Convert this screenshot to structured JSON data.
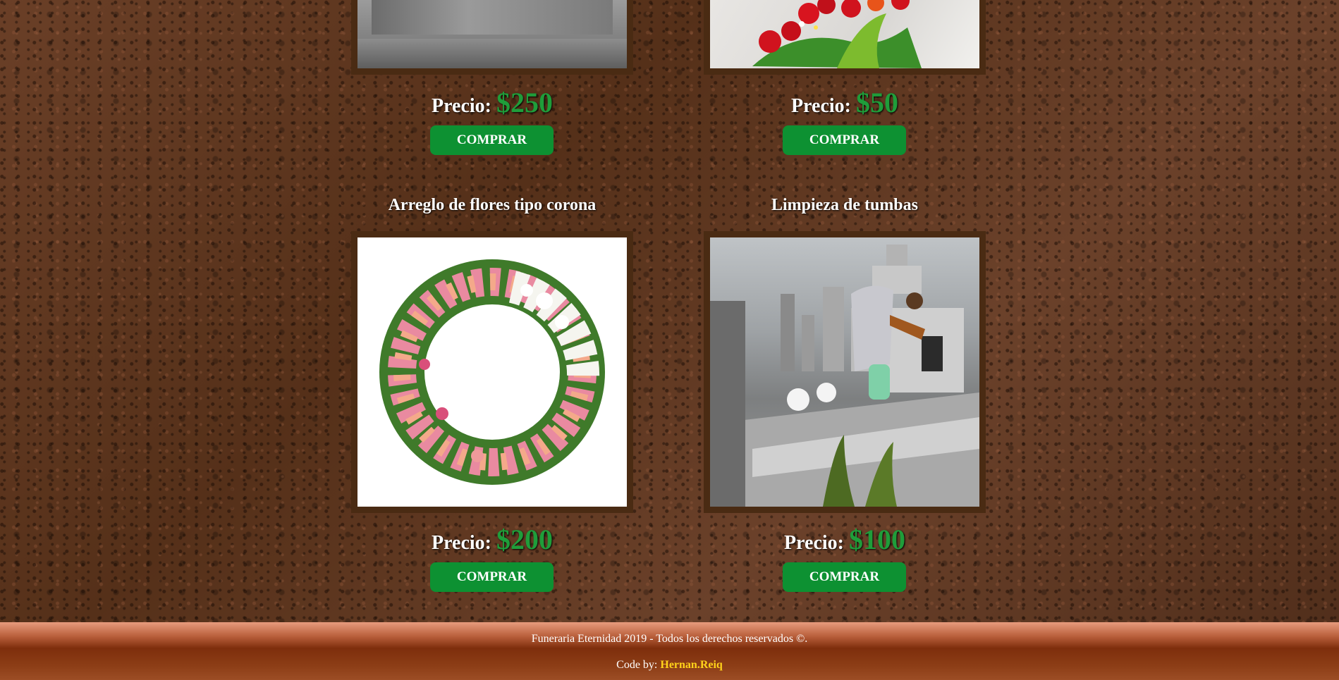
{
  "products": [
    {
      "title": "",
      "price_label": "Precio:",
      "price": "$250",
      "button": "COMPRAR",
      "image": "tombstone-photo"
    },
    {
      "title": "",
      "price_label": "Precio:",
      "price": "$50",
      "button": "COMPRAR",
      "image": "flower-arrangement-photo"
    },
    {
      "title": "Arreglo de flores tipo corona",
      "price_label": "Precio:",
      "price": "$200",
      "button": "COMPRAR",
      "image": "flower-wreath-photo"
    },
    {
      "title": "Limpieza de tumbas",
      "price_label": "Precio:",
      "price": "$100",
      "button": "COMPRAR",
      "image": "tomb-cleaning-photo"
    }
  ],
  "footer": {
    "copyright": "Funeraria Eternidad 2019 - Todos los derechos reservados ©.",
    "code_by_label": "Code by:",
    "author": "Hernan.Reiq"
  },
  "colors": {
    "price_green": "#1f9d3a",
    "button_green": "#0d9132",
    "frame_brown": "#4a2b13",
    "author_yellow": "#ffd21a"
  }
}
